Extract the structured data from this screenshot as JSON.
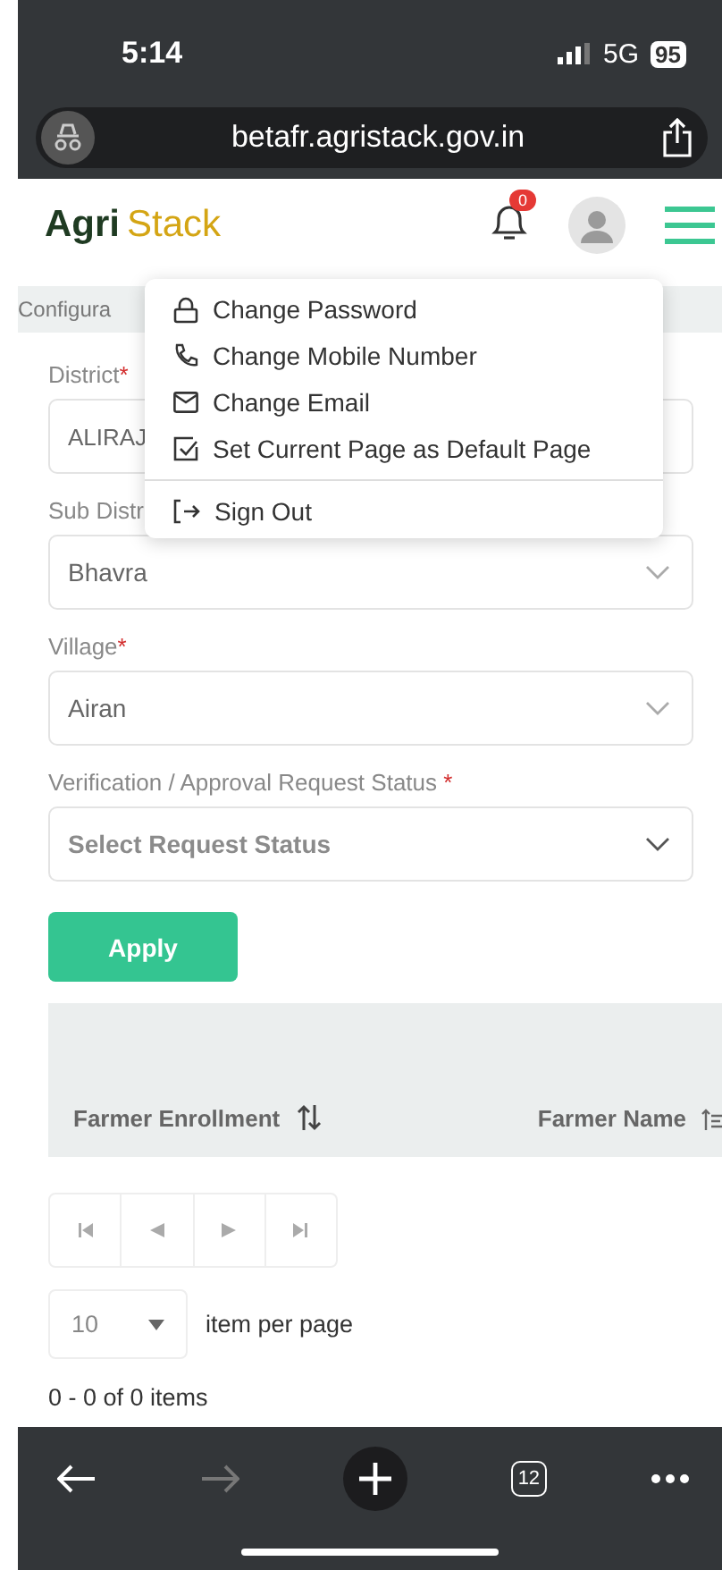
{
  "status_bar": {
    "time": "5:14",
    "network": "5G",
    "battery": "95"
  },
  "browser": {
    "url": "betafr.agristack.gov.in",
    "tab_count": "12"
  },
  "header": {
    "logo_first": "Agri",
    "logo_second": "Stack",
    "notification_count": "0"
  },
  "breadcrumb": "Configura",
  "user_menu": {
    "items": [
      {
        "kind": "lock",
        "label": "Change Password"
      },
      {
        "kind": "phone",
        "label": "Change Mobile Number"
      },
      {
        "kind": "mail",
        "label": "Change Email"
      },
      {
        "kind": "check",
        "label": "Set Current Page as Default Page"
      },
      {
        "kind": "signout",
        "label": "Sign Out"
      }
    ]
  },
  "filters": [
    {
      "label": "District",
      "required_mark": "*",
      "value": "ALIRAJ",
      "chevron": false
    },
    {
      "label": "Sub Distr",
      "value": "Bhavra",
      "chevron": true
    },
    {
      "label": "Village",
      "required_mark": "*",
      "value": "Airan",
      "chevron": true
    },
    {
      "label": "Verification / Approval Request Status ",
      "required_mark": "*",
      "placeholder": "Select Request Status",
      "chevron": true
    }
  ],
  "apply_button": "Apply",
  "table": {
    "columns": [
      "Farmer Enrollment",
      "Farmer Name"
    ]
  },
  "pagination": {
    "page_size": "10",
    "page_size_label": "item per page",
    "summary": "0 - 0 of 0 items"
  }
}
